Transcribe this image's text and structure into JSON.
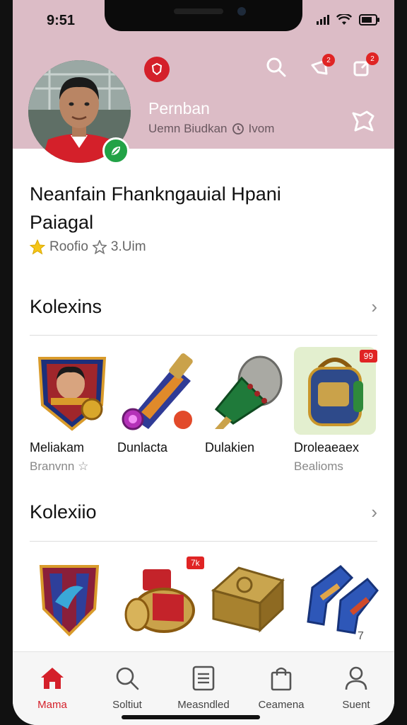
{
  "status_bar": {
    "time": "9:51"
  },
  "header": {
    "profile_name": "Pernban",
    "profile_meta": "Uemn Biudkan",
    "profile_meta_extra": "Ivom",
    "notif_count_1": "2",
    "notif_count_2": "2"
  },
  "product": {
    "title_line1": "Neanfain Fhankngauial Hpani",
    "title_line2": "Paiagal",
    "rating_label": "Roofio",
    "rating_value": "3.Uim"
  },
  "sections": [
    {
      "title": "Kolexins",
      "items": [
        {
          "name": "Meliakam",
          "sub": "Branvnn"
        },
        {
          "name": "Dunlacta",
          "sub": ""
        },
        {
          "name": "Dulakien",
          "sub": ""
        },
        {
          "name": "Droleaeaex",
          "sub": "Bealioms"
        }
      ],
      "tag_4": "99"
    },
    {
      "title": "Kolexiio",
      "tag_2": "7k",
      "scroll_hint": "7"
    }
  ],
  "tabbar": {
    "tabs": [
      {
        "label": "Mama",
        "icon": "home-icon"
      },
      {
        "label": "Soltiut",
        "icon": "search-icon"
      },
      {
        "label": "Measndled",
        "icon": "list-icon"
      },
      {
        "label": "Ceamena",
        "icon": "bag-icon"
      },
      {
        "label": "Suent",
        "icon": "profile-icon"
      }
    ]
  },
  "colors": {
    "accent": "#d4202a",
    "header_bg": "#dcbcc6",
    "verified": "#22a246"
  }
}
